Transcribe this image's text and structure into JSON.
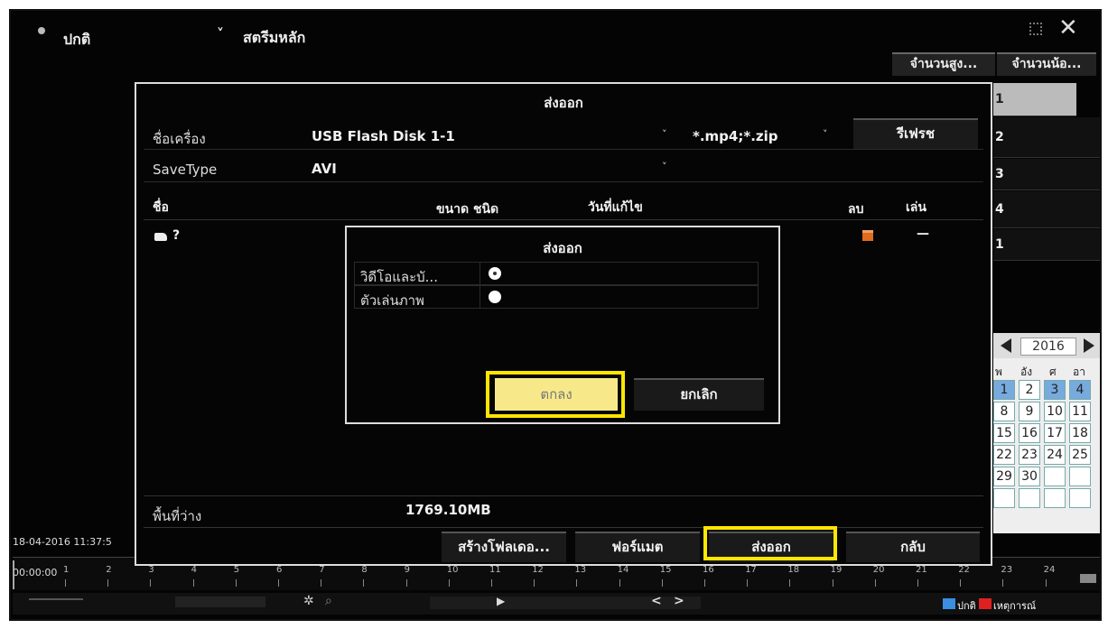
{
  "topbar": {
    "mode_label": "ปกติ",
    "stream_label": "สตรีมหลัก",
    "chevron": "˅"
  },
  "right_panel": {
    "col_high": "จำนวนสูง...",
    "col_low": "จำนวนน้อ...",
    "cameras": [
      "1",
      "2",
      "3",
      "4",
      "1"
    ],
    "calendar": {
      "year": "2016",
      "weekdays": [
        "พ",
        "อัง",
        "ศ",
        "อา"
      ],
      "rows": [
        [
          "1",
          "2",
          "3",
          "4"
        ],
        [
          "8",
          "9",
          "10",
          "11"
        ],
        [
          "15",
          "16",
          "17",
          "18"
        ],
        [
          "22",
          "23",
          "24",
          "25"
        ],
        [
          "29",
          "30",
          "",
          ""
        ]
      ]
    }
  },
  "timeline": {
    "datetime": "18-04-2016 11:37:5",
    "time": "00:00:00",
    "hours": [
      "1",
      "2",
      "3",
      "4",
      "5",
      "6",
      "7",
      "8",
      "9",
      "10",
      "11",
      "12",
      "13",
      "14",
      "15",
      "16",
      "17",
      "18",
      "19",
      "20",
      "21",
      "22",
      "23",
      "24"
    ],
    "legend_normal": "ปกติ",
    "legend_event": "เหตุการณ์",
    "colors": {
      "normal": "#3a8fe0",
      "event": "#e02020"
    }
  },
  "export_dialog": {
    "title": "ส่งออก",
    "device_label": "ชื่อเครื่อง",
    "device_value": "USB Flash Disk 1-1",
    "filter_value": "*.mp4;*.zip",
    "refresh_label": "รีเฟรช",
    "savetype_label": "SaveType",
    "savetype_value": "AVI",
    "col_name": "ชื่อ",
    "col_size_type": "ขนาด ชนิด",
    "col_modified": "วันที่แก้ไข",
    "col_delete": "ลบ",
    "col_play": "เล่น",
    "file_name": "?",
    "file_play": "—",
    "free_label": "พื้นที่ว่าง",
    "free_value": "1769.10MB",
    "btn_new_folder": "สร้างโฟลเดอ...",
    "btn_format": "ฟอร์แมต",
    "btn_export": "ส่งออก",
    "btn_back": "กลับ"
  },
  "sub_dialog": {
    "title": "ส่งออก",
    "option1": "วิดีโอและบั...",
    "option2": "ตัวเล่นภาพ",
    "ok_label": "ตกลง",
    "cancel_label": "ยกเลิก"
  }
}
